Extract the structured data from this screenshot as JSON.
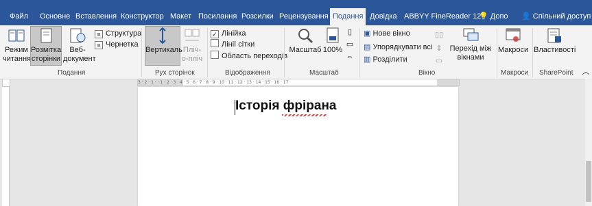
{
  "tabs": [
    {
      "label": "Файл"
    },
    {
      "label": "Основне"
    },
    {
      "label": "Вставлення"
    },
    {
      "label": "Конструктор"
    },
    {
      "label": "Макет"
    },
    {
      "label": "Посилання"
    },
    {
      "label": "Розсилки"
    },
    {
      "label": "Рецензування"
    },
    {
      "label": "Подання"
    },
    {
      "label": "Довідка"
    },
    {
      "label": "ABBYY FineReader 12"
    }
  ],
  "tell_me": "Допо",
  "share": "Спільний доступ",
  "groups": {
    "views": {
      "label": "Подання",
      "reading": "Режим читання",
      "print_layout": "Розмітка сторінки",
      "web_layout": "Веб-документ",
      "outline": "Структура",
      "draft": "Чернетка"
    },
    "page_movement": {
      "label": "Рух сторінок",
      "vertical": "Вертикаль",
      "side": "Пліч-о-пліч"
    },
    "show": {
      "label": "Відображення",
      "ruler": "Лінійка",
      "gridlines": "Лінії сітки",
      "nav_pane": "Область переходів"
    },
    "zoom": {
      "label": "Масштаб",
      "zoom": "Масштаб",
      "hundred": "100%"
    },
    "window": {
      "label": "Вікно",
      "new_window": "Нове вікно",
      "arrange": "Упорядкувати всі",
      "split": "Розділити",
      "switch": "Перехід між вікнами"
    },
    "macros": {
      "label": "Макроси",
      "macros": "Макроси"
    },
    "sharepoint": {
      "label": "SharePoint",
      "properties": "Властивості"
    }
  },
  "ruler_text": "3 · 2 · 1 · · 1 · 2 · 3 · 4 · 5 · 6 · 7 · 8 · 9 · 10 · 11 · 12 · 13 · 14 · 15 · 16 · 17",
  "document": {
    "title": "Історія фрірана"
  },
  "colors": {
    "accent": "#2b579a",
    "ribbon": "#f3f3f3"
  }
}
